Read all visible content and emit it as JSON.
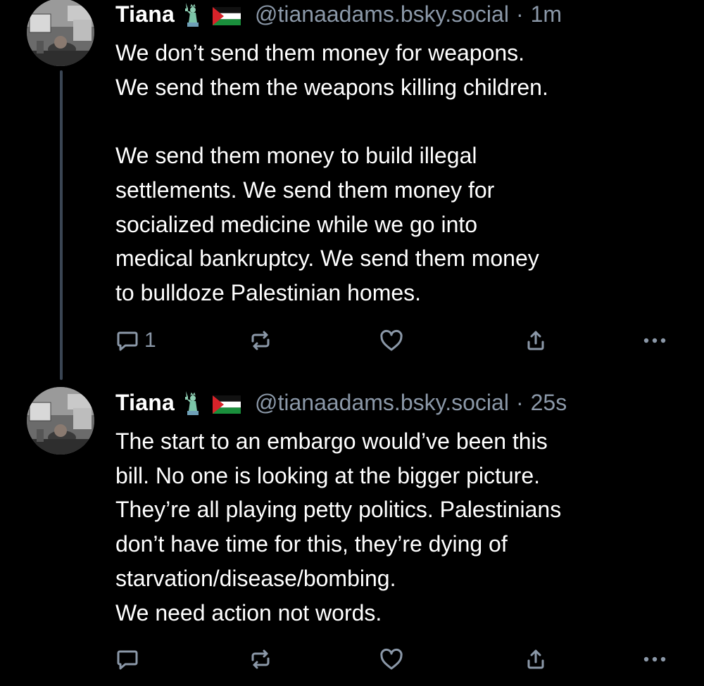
{
  "posts": [
    {
      "author": "Tiana",
      "emojis": [
        "statue-of-liberty",
        "palestine-flag"
      ],
      "handle": "@tianaadams.bsky.social",
      "separator": "·",
      "time": "1m",
      "lines": [
        "We don’t send them money for weapons.",
        "We send them the weapons killing children.",
        "",
        "We send them money to build illegal",
        "settlements. We send them money for",
        "socialized medicine while we go into",
        "medical bankruptcy. We send them money",
        "to bulldoze Palestinian homes."
      ],
      "reply_count": "1",
      "has_thread_line": true
    },
    {
      "author": "Tiana",
      "emojis": [
        "statue-of-liberty",
        "palestine-flag"
      ],
      "handle": "@tianaadams.bsky.social",
      "separator": "·",
      "time": "25s",
      "lines": [
        "The start to an embargo would’ve been this",
        "bill. No one is looking at the bigger picture.",
        "They’re all playing petty politics. Palestinians",
        "don’t have time for this, they’re dying of",
        "starvation/disease/bombing.",
        "We need action not words."
      ],
      "reply_count": "",
      "has_thread_line": false
    }
  ],
  "icons": {
    "reply": "reply-icon",
    "repost": "repost-icon",
    "like": "heart-icon",
    "share": "share-icon",
    "more": "more-icon"
  },
  "colors": {
    "background": "#000000",
    "text": "#ffffff",
    "muted": "#8b98a8",
    "thread_line": "#3a4553"
  }
}
